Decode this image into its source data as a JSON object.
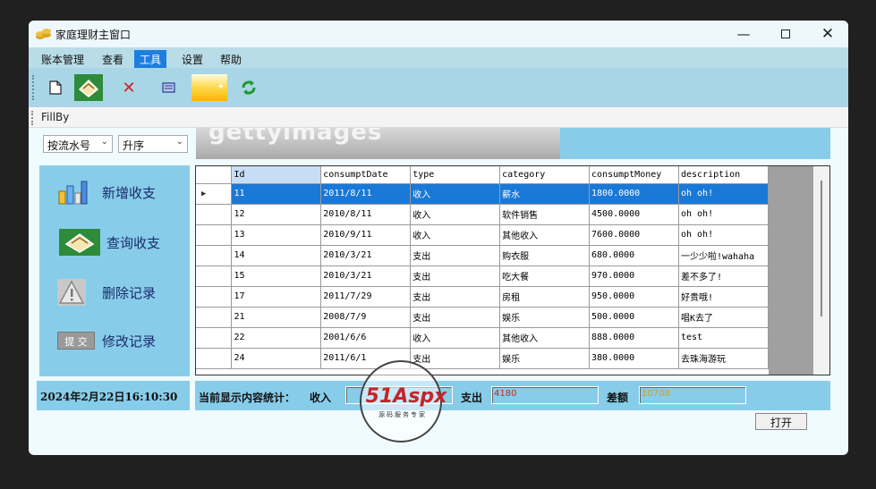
{
  "window": {
    "title": "家庭理财主窗口"
  },
  "menu": [
    {
      "label": "账本管理"
    },
    {
      "label": "查看"
    },
    {
      "label": "工具"
    },
    {
      "label": "设置"
    },
    {
      "label": "帮助"
    }
  ],
  "toolbar_icons": [
    "new-icon",
    "query-icon",
    "delete-icon",
    "edit-icon",
    "yellow-panel-icon",
    "refresh-icon"
  ],
  "fillby": {
    "label": "FillBy"
  },
  "filters": {
    "sort_field": "按流水号",
    "sort_order": "升序"
  },
  "banner": {
    "image_text": "gettyimages"
  },
  "nav": [
    {
      "label": "新增收支",
      "icon": "chart-icon"
    },
    {
      "label": "查询收支",
      "icon": "query-icon"
    },
    {
      "label": "删除记录",
      "icon": "warning-icon"
    },
    {
      "label": "修改记录",
      "icon": "submit-icon",
      "icon_text": "提 交"
    }
  ],
  "grid": {
    "columns": [
      "Id",
      "consumptDate",
      "type",
      "category",
      "consumptMoney",
      "description"
    ],
    "rows": [
      [
        "11",
        "2011/8/11",
        "收入",
        "薪水",
        "1800.0000",
        "oh oh!"
      ],
      [
        "12",
        "2010/8/11",
        "收入",
        "软件销售",
        "4500.0000",
        "oh oh!"
      ],
      [
        "13",
        "2010/9/11",
        "收入",
        "其他收入",
        "7600.0000",
        "oh oh!"
      ],
      [
        "14",
        "2010/3/21",
        "支出",
        "购衣服",
        "680.0000",
        "一少少啦!wahaha"
      ],
      [
        "15",
        "2010/3/21",
        "支出",
        "吃大餐",
        "970.0000",
        "差不多了!"
      ],
      [
        "17",
        "2011/7/29",
        "支出",
        "房租",
        "950.0000",
        "好贵哦!"
      ],
      [
        "21",
        "2008/7/9",
        "支出",
        "娱乐",
        "500.0000",
        "唱K去了"
      ],
      [
        "22",
        "2001/6/6",
        "收入",
        "其他收入",
        "888.0000",
        "test"
      ],
      [
        "24",
        "2011/6/1",
        "支出",
        "娱乐",
        "380.0000",
        "去珠海游玩"
      ]
    ],
    "selected_row": 0
  },
  "status": {
    "datetime": "2024年2月22日16:10:30",
    "summary_label": "当前显示内容统计：",
    "income_label": "收入",
    "income_value": "",
    "expense_label": "支出",
    "expense_value": "4180",
    "diff_label": "差额",
    "diff_value": "10708"
  },
  "open_button": "打开",
  "watermark": {
    "brand": "51Aspx",
    "sub": "源码服务专家"
  },
  "colors": {
    "panel": "#87cdea",
    "selection": "#1a78d6",
    "menu_active": "#1e7ee0",
    "expense_text": "#d22222",
    "diff_text": "#d0a020"
  }
}
